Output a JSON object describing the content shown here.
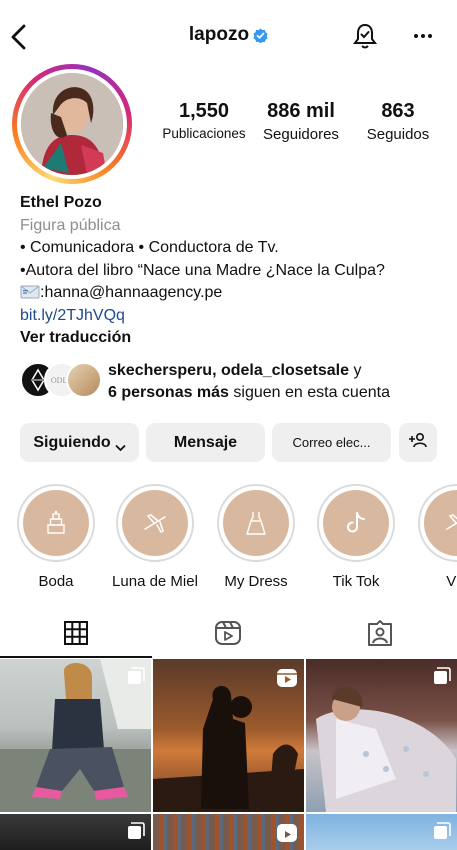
{
  "header": {
    "username": "lapozo",
    "icons": {
      "back": "chevron-left-icon",
      "verified": "verified-badge-icon",
      "bell": "notification-bell-icon",
      "more": "more-horizontal-icon"
    }
  },
  "stats": [
    {
      "value": "1,550",
      "label": "Publicaciones"
    },
    {
      "value": "886 mil",
      "label": "Seguidores"
    },
    {
      "value": "863",
      "label": "Seguidos"
    }
  ],
  "bio": {
    "name": "Ethel Pozo",
    "category": "Figura pública",
    "lines": [
      "• Comunicadora • Conductora de Tv.",
      "•Autora del libro “Nace una Madre ¿Nace la Culpa?",
      ":hanna@hannaagency.pe"
    ],
    "link": "bit.ly/2TJhVQq",
    "translate": "Ver traducción"
  },
  "followed_by": {
    "names": "skechersperu, odela_closetsale",
    "connector": " y",
    "more": "6 personas más",
    "suffix": " siguen en esta cuenta"
  },
  "actions": {
    "following": "Siguiendo",
    "message": "Mensaje",
    "email": "Correo elec...",
    "suggest": "add-person-icon"
  },
  "highlights": [
    {
      "label": "Boda",
      "icon": "wedding-cake-icon"
    },
    {
      "label": "Luna de Miel",
      "icon": "airplane-icon"
    },
    {
      "label": "My Dress",
      "icon": "dress-icon"
    },
    {
      "label": "Tik Tok",
      "icon": "tiktok-icon"
    },
    {
      "label": "Via",
      "icon": "airplane-icon"
    }
  ],
  "tabs": [
    {
      "name": "grid",
      "icon": "grid-icon",
      "active": true
    },
    {
      "name": "reels",
      "icon": "reels-icon",
      "active": false
    },
    {
      "name": "tagged",
      "icon": "tagged-person-icon",
      "active": false
    }
  ],
  "colors": {
    "accent_link": "#1e4a89",
    "verified": "#3897f0",
    "button_bg": "#efefef",
    "highlight_bg": "#d8b9a0"
  }
}
